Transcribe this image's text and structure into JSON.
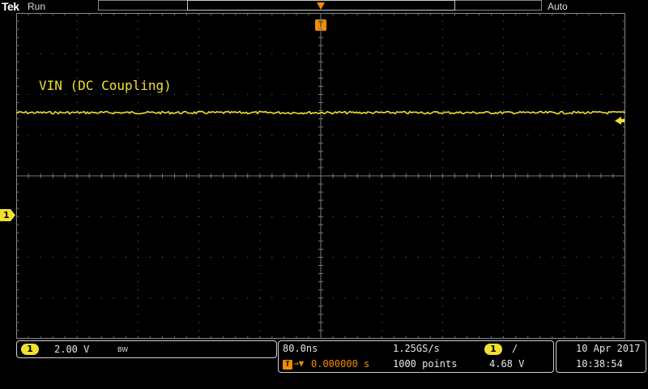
{
  "header": {
    "brand": "Tek",
    "acquisition_state": "Run",
    "trigger_mode": "Auto"
  },
  "markers": {
    "trigger_position_glyph": "T",
    "channel_ground_glyph": "1"
  },
  "waveform": {
    "label": "VIN (DC Coupling)",
    "color": "#f0e030"
  },
  "channel_readout": {
    "channel": "1",
    "scale": "2.00 V",
    "bandwidth_limit": "BW"
  },
  "timebase_readout": {
    "horizontal_scale": "80.0ns",
    "sample_rate": "1.25GS/s",
    "trigger_glyph": "T",
    "trigger_delay_arrow": "→▼",
    "trigger_delay": "0.000000 s",
    "record_length": "1000 points",
    "trigger_source": "1",
    "trigger_slope_icon": "/",
    "trigger_level": "4.68 V"
  },
  "datetime": {
    "date": "10 Apr 2017",
    "time": "10:38:54"
  },
  "colors": {
    "channel1": "#f0e030",
    "trigger": "#f08c00",
    "grid": "#7a7a7a"
  }
}
